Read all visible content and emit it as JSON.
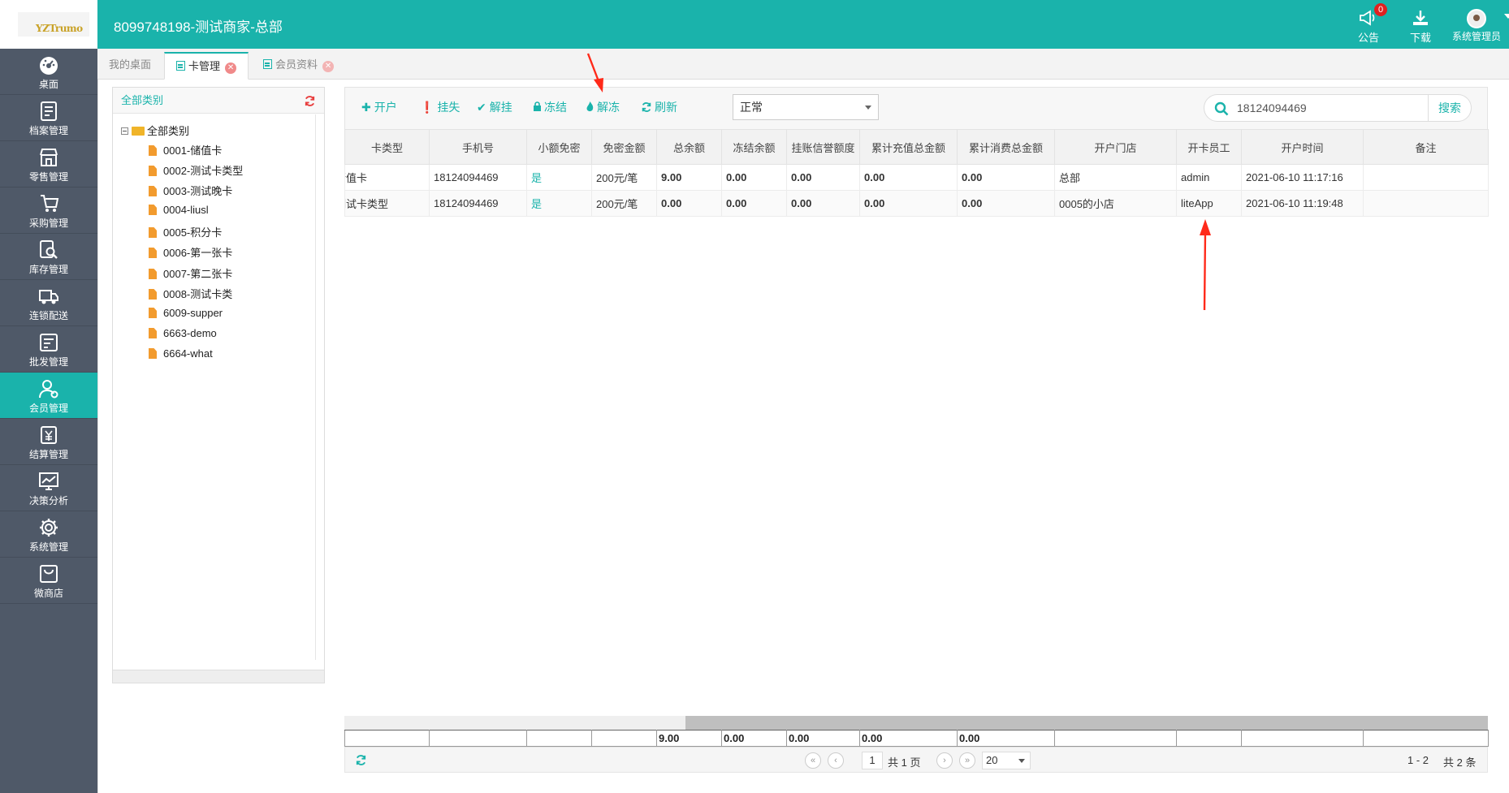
{
  "header": {
    "logo_text": "YZTrumo",
    "title": "8099748198-测试商家-总部",
    "notice_label": "公告",
    "notice_count": "0",
    "download_label": "下载",
    "user_label": "系统管理员"
  },
  "sidebar": {
    "items": [
      {
        "label": "桌面",
        "icon": "dashboard-icon"
      },
      {
        "label": "档案管理",
        "icon": "archive-icon"
      },
      {
        "label": "零售管理",
        "icon": "store-icon"
      },
      {
        "label": "采购管理",
        "icon": "cart-icon"
      },
      {
        "label": "库存管理",
        "icon": "inventory-search-icon"
      },
      {
        "label": "连锁配送",
        "icon": "truck-icon"
      },
      {
        "label": "批发管理",
        "icon": "wholesale-icon"
      },
      {
        "label": "会员管理",
        "icon": "member-icon",
        "active": true
      },
      {
        "label": "结算管理",
        "icon": "settlement-icon"
      },
      {
        "label": "决策分析",
        "icon": "chart-icon"
      },
      {
        "label": "系统管理",
        "icon": "gear-icon"
      },
      {
        "label": "微商店",
        "icon": "shop-bag-icon"
      }
    ]
  },
  "tabs": [
    {
      "label": "我的桌面"
    },
    {
      "label": "卡管理",
      "active": true
    },
    {
      "label": "会员资料"
    }
  ],
  "tree": {
    "header": "全部类别",
    "root": "全部类别",
    "nodes": [
      "0001-储值卡",
      "0002-测试卡类型",
      "0003-测试晚卡",
      "0004-liusl",
      "0005-积分卡",
      "0006-第一张卡",
      "0007-第二张卡",
      "0008-测试卡类",
      "6009-supper",
      "6663-demo",
      "6664-what"
    ]
  },
  "toolbar": {
    "open": "开户",
    "report_loss": "挂失",
    "unreport": "解挂",
    "freeze": "冻结",
    "unfreeze": "解冻",
    "refresh": "刷新",
    "status_value": "正常",
    "search_value": "18124094469",
    "search_button": "搜索"
  },
  "grid": {
    "columns": [
      "卡类型",
      "手机号",
      "小额免密",
      "免密金额",
      "总余额",
      "冻结余额",
      "挂账信誉额度",
      "累计充值总金额",
      "累计消费总金额",
      "开户门店",
      "开卡员工",
      "开户时间",
      "备注"
    ],
    "rows": [
      [
        "储值卡",
        "18124094469",
        "是",
        "200元/笔",
        "9.00",
        "0.00",
        "0.00",
        "0.00",
        "0.00",
        "总部",
        "admin",
        "2021-06-10 11:17:16",
        ""
      ],
      [
        "测试卡类型",
        "18124094469",
        "是",
        "200元/笔",
        "0.00",
        "0.00",
        "0.00",
        "0.00",
        "0.00",
        "0005的小店",
        "liteApp",
        "2021-06-10 11:19:48",
        ""
      ]
    ],
    "footer": [
      "",
      "",
      "",
      "",
      "9.00",
      "0.00",
      "0.00",
      "0.00",
      "0.00",
      "",
      "",
      "",
      ""
    ]
  },
  "pager": {
    "page": "1",
    "total_pages": "共 1 页",
    "page_size": "20",
    "range": "1 - 2",
    "total": "共 2 条"
  },
  "colors": {
    "primary": "#1ab3ab",
    "sidebar": "#4f5968",
    "annotation": "#ff2a1a"
  }
}
